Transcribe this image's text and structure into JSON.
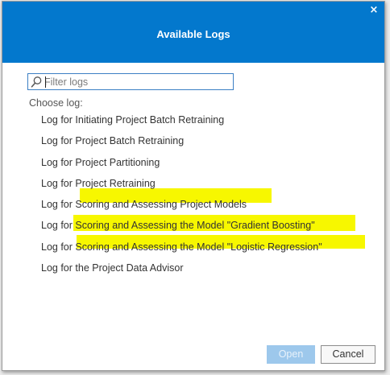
{
  "dialog": {
    "title": "Available Logs",
    "close_label": "×"
  },
  "filter": {
    "placeholder": "Filter logs",
    "value": ""
  },
  "choose_label": "Choose log:",
  "logs": [
    {
      "label": "Log for Initiating Project Batch Retraining",
      "highlighted": false
    },
    {
      "label": "Log for Project Batch Retraining",
      "highlighted": false
    },
    {
      "label": "Log for Project Partitioning",
      "highlighted": false
    },
    {
      "label": "Log for Project Retraining",
      "highlighted": false
    },
    {
      "label": "Log for Scoring and Assessing Project Models",
      "highlighted": true
    },
    {
      "label": "Log for Scoring and Assessing the Model \"Gradient Boosting\"",
      "highlighted": true
    },
    {
      "label": "Log for Scoring and Assessing the Model \"Logistic Regression\"",
      "highlighted": true
    },
    {
      "label": "Log for the Project Data Advisor",
      "highlighted": false
    }
  ],
  "buttons": {
    "open_label": "Open",
    "open_enabled": false,
    "cancel_label": "Cancel"
  },
  "colors": {
    "titlebar": "#0378cd",
    "highlight": "#f7f700",
    "open_disabled": "#9dc8ec"
  }
}
